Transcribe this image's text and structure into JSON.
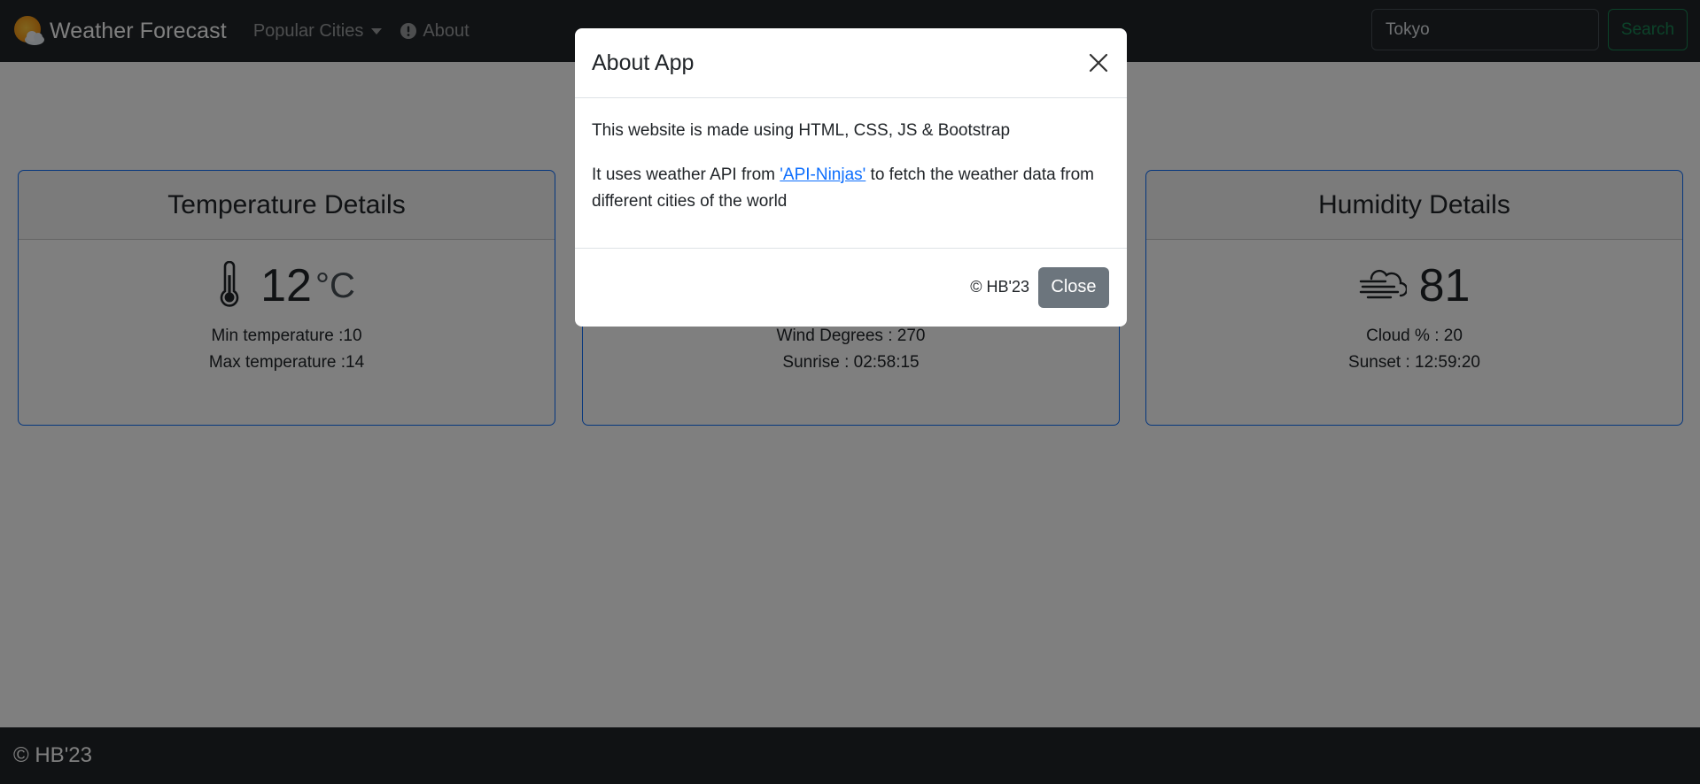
{
  "navbar": {
    "brand": "Weather Forecast",
    "cities_label": "Popular Cities",
    "about_label": "About",
    "search_value": "Tokyo",
    "search_button": "Search"
  },
  "cards": {
    "temperature": {
      "title": "Temperature Details",
      "value": "12",
      "unit": "°C",
      "line1": "Min temperature :10",
      "line2": "Max temperature :14"
    },
    "wind": {
      "line1": "Wind Degrees : 270",
      "line2": "Sunrise : 02:58:15"
    },
    "humidity": {
      "title": "Humidity Details",
      "value": "81",
      "line1": "Cloud % : 20",
      "line2": "Sunset : 12:59:20"
    }
  },
  "footer": {
    "text": "© HB'23"
  },
  "modal": {
    "title": "About App",
    "body1": "This website is made using HTML, CSS, JS & Bootstrap",
    "body2_prefix": "It uses weather API from ",
    "body2_link": "'API-Ninjas'",
    "body2_suffix": " to fetch the weather data from different cities of the world",
    "copyright": "© HB'23",
    "close_button": "Close"
  },
  "icons": {
    "brand": "sun-cloud-icon",
    "about": "info-circle-icon",
    "temperature": "thermometer-icon",
    "humidity": "wind-cloud-icon",
    "close": "close-icon"
  },
  "colors": {
    "navbar_bg": "#212529",
    "card_border": "#0d6efd",
    "search_button": "#198754",
    "close_button": "#6c757d",
    "link": "#0d6efd"
  }
}
